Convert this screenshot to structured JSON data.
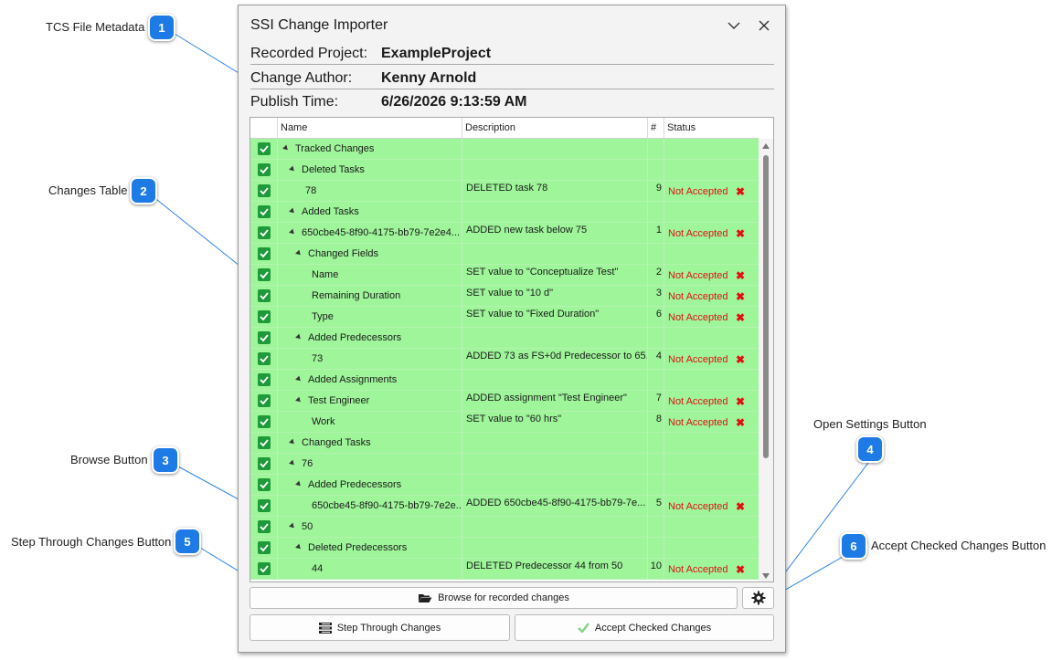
{
  "callouts": [
    {
      "num": "1",
      "label": "TCS File Metadata"
    },
    {
      "num": "2",
      "label": "Changes Table"
    },
    {
      "num": "3",
      "label": "Browse Button"
    },
    {
      "num": "4",
      "label": "Open Settings Button"
    },
    {
      "num": "5",
      "label": "Step Through Changes Button"
    },
    {
      "num": "6",
      "label": "Accept Checked Changes Button"
    }
  ],
  "window": {
    "title": "SSI Change Importer",
    "chevron_icon": "chevron-down-icon",
    "close_icon": "close-icon"
  },
  "metadata": {
    "project_label": "Recorded Project:",
    "project_value": "ExampleProject",
    "author_label": "Change Author:",
    "author_value": "Kenny Arnold",
    "time_label": "Publish Time:",
    "time_value": "6/26/2026 9:13:59 AM"
  },
  "table": {
    "columns": {
      "name": "Name",
      "description": "Description",
      "num": "#",
      "status": "Status"
    },
    "rows": [
      {
        "name": "Tracked Changes",
        "expander": true,
        "description": "",
        "num": "",
        "status": ""
      },
      {
        "name": "Deleted Tasks",
        "expander": true,
        "description": "",
        "num": "",
        "status": ""
      },
      {
        "name": "78",
        "expander": false,
        "description": "DELETED task 78",
        "num": "9",
        "status": "Not Accepted"
      },
      {
        "name": "Added Tasks",
        "expander": true,
        "description": "",
        "num": "",
        "status": ""
      },
      {
        "name": "650cbe45-8f90-4175-bb79-7e2e4...",
        "expander": true,
        "description": "ADDED new task below 75",
        "num": "1",
        "status": "Not Accepted"
      },
      {
        "name": "Changed Fields",
        "expander": true,
        "description": "",
        "num": "",
        "status": ""
      },
      {
        "name": "Name",
        "expander": false,
        "description": "SET value to \"Conceptualize Test\"",
        "num": "2",
        "status": "Not Accepted"
      },
      {
        "name": "Remaining Duration",
        "expander": false,
        "description": "SET value to \"10 d\"",
        "num": "3",
        "status": "Not Accepted"
      },
      {
        "name": "Type",
        "expander": false,
        "description": "SET value to \"Fixed Duration\"",
        "num": "6",
        "status": "Not Accepted"
      },
      {
        "name": "Added Predecessors",
        "expander": true,
        "description": "",
        "num": "",
        "status": ""
      },
      {
        "name": "73",
        "expander": false,
        "description": "ADDED 73 as FS+0d Predecessor to 65...",
        "num": "4",
        "status": "Not Accepted"
      },
      {
        "name": "Added Assignments",
        "expander": true,
        "description": "",
        "num": "",
        "status": ""
      },
      {
        "name": "Test Engineer",
        "expander": true,
        "description": "ADDED assignment \"Test Engineer\"",
        "num": "7",
        "status": "Not Accepted"
      },
      {
        "name": "Work",
        "expander": false,
        "description": "SET value to \"60 hrs\"",
        "num": "8",
        "status": "Not Accepted"
      },
      {
        "name": "Changed Tasks",
        "expander": true,
        "description": "",
        "num": "",
        "status": ""
      },
      {
        "name": "76",
        "expander": true,
        "description": "",
        "num": "",
        "status": ""
      },
      {
        "name": "Added Predecessors",
        "expander": true,
        "description": "",
        "num": "",
        "status": ""
      },
      {
        "name": "650cbe45-8f90-4175-bb79-7e2e...",
        "expander": false,
        "description": "ADDED 650cbe45-8f90-4175-bb79-7e...",
        "num": "5",
        "status": "Not Accepted"
      },
      {
        "name": "50",
        "expander": true,
        "description": "",
        "num": "",
        "status": ""
      },
      {
        "name": "Deleted Predecessors",
        "expander": true,
        "description": "",
        "num": "",
        "status": ""
      },
      {
        "name": "44",
        "expander": false,
        "description": "DELETED Predecessor 44 from 50",
        "num": "10",
        "status": "Not Accepted"
      }
    ]
  },
  "buttons": {
    "browse": "Browse for recorded changes",
    "settings_icon": "gear-icon",
    "step": "Step Through Changes",
    "accept": "Accept Checked Changes"
  },
  "colors": {
    "row_bg": "#9ef59a",
    "checkbox": "#1f9a3a",
    "status_text": "#e01010",
    "badge": "#1e7be6",
    "leader_line": "#1e7be6"
  }
}
